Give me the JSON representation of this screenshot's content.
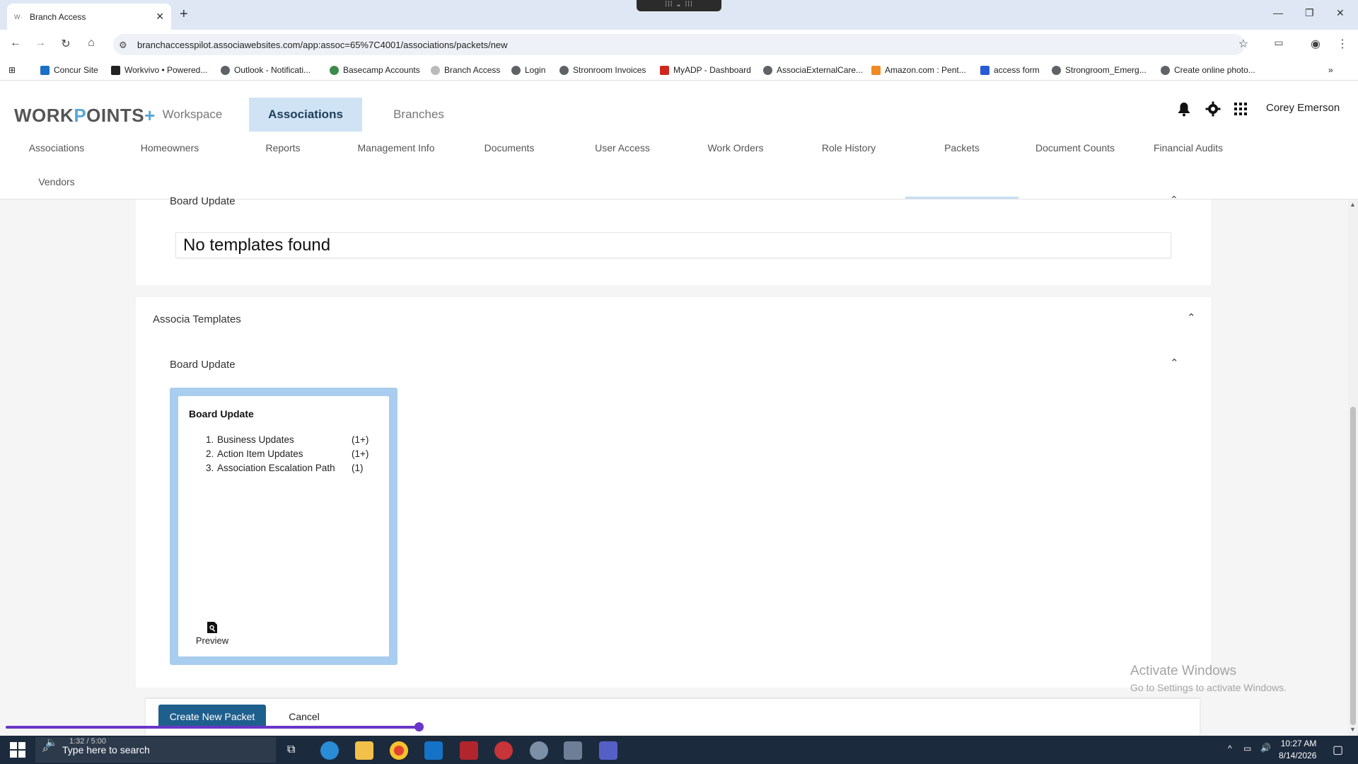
{
  "browser": {
    "tab_title": "Branch Access",
    "tab_favicon": "W·",
    "url": "branchaccesspilot.associawebsites.com/app:assoc=65%7C4001/associations/packets/new",
    "bookmarks": [
      "Concur Site",
      "Workvivo • Powered...",
      "Outlook - Notificati...",
      "Basecamp Accounts",
      "Branch Access",
      "Login",
      "Stronroom Invoices",
      "MyADP - Dashboard",
      "AssociaExternalCare...",
      "Amazon.com : Pent...",
      "access form",
      "Strongroom_Emerg...",
      "Create online photo..."
    ]
  },
  "app": {
    "logo_w": "W",
    "logo_ork": "ORK",
    "logo_p": "P",
    "logo_oints": "OINTS",
    "logo_plus": "+",
    "main_tabs": [
      "Workspace",
      "Associations",
      "Branches"
    ],
    "active_tab": "Associations",
    "user_name": "Corey Emerson",
    "sub_nav": [
      "Associations",
      "Homeowners",
      "Reports",
      "Management Info",
      "Documents",
      "User Access",
      "Work Orders",
      "Role History",
      "Packets",
      "Document Counts",
      "Financial Audits",
      "Vendors"
    ],
    "active_sub_nav": "Packets"
  },
  "content": {
    "top_group_label": "Board Update",
    "no_templates": "No templates found",
    "associa_section_title": "Associa Templates",
    "associa_group_label": "Board Update",
    "template_card": {
      "title": "Board Update",
      "items": [
        {
          "num": "1.",
          "name": "Business Updates",
          "count": "(1+)"
        },
        {
          "num": "2.",
          "name": "Action Item Updates",
          "count": "(1+)"
        },
        {
          "num": "3.",
          "name": "Association Escalation Path",
          "count": "(1)"
        }
      ],
      "preview_label": "Preview"
    },
    "activate_title": "Activate Windows",
    "activate_sub": "Go to Settings to activate Windows.",
    "create_button": "Create New Packet",
    "cancel_button": "Cancel"
  },
  "video_overlay": {
    "time": "1:32 / 5:00"
  },
  "taskbar": {
    "search_placeholder": "Type here to search",
    "clock_time": "10:27 AM",
    "clock_date": "8/14/2026"
  },
  "colors": {
    "accent_tab_bg": "#cfe3f5",
    "primary_button": "#1f5f8d",
    "card_border": "#a9cdee",
    "progress": "#6a35c9"
  }
}
